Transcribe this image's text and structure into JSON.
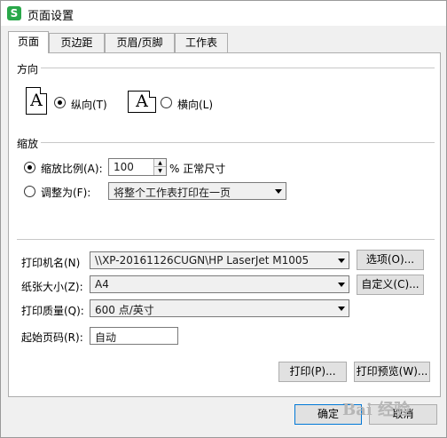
{
  "window": {
    "title": "页面设置",
    "app_icon_letter": "S"
  },
  "tabs": [
    {
      "label": "页面",
      "active": true
    },
    {
      "label": "页边距",
      "active": false
    },
    {
      "label": "页眉/页脚",
      "active": false
    },
    {
      "label": "工作表",
      "active": false
    }
  ],
  "orientation": {
    "group_label": "方向",
    "icon_glyph": "A",
    "portrait_label": "纵向(T)",
    "landscape_label": "横向(L)",
    "selected": "portrait"
  },
  "scaling": {
    "group_label": "缩放",
    "adjust_to_label": "缩放比例(A):",
    "adjust_value": "100",
    "percent_suffix": "% 正常尺寸",
    "fit_to_label": "调整为(F):",
    "fit_option": "将整个工作表打印在一页",
    "selected": "adjust"
  },
  "printer": {
    "label": "打印机名(N)",
    "value": "\\\\XP-20161126CUGN\\HP LaserJet M1005",
    "options_button": "选项(O)..."
  },
  "paper_size": {
    "label": "纸张大小(Z):",
    "value": "A4",
    "custom_button": "自定义(C)..."
  },
  "print_quality": {
    "label": "打印质量(Q):",
    "value": "600 点/英寸"
  },
  "first_page": {
    "label": "起始页码(R):",
    "value": "自动"
  },
  "actions": {
    "print": "打印(P)...",
    "print_preview": "打印预览(W)...",
    "ok": "确定",
    "cancel": "取消"
  },
  "watermark": "Bai 经验"
}
